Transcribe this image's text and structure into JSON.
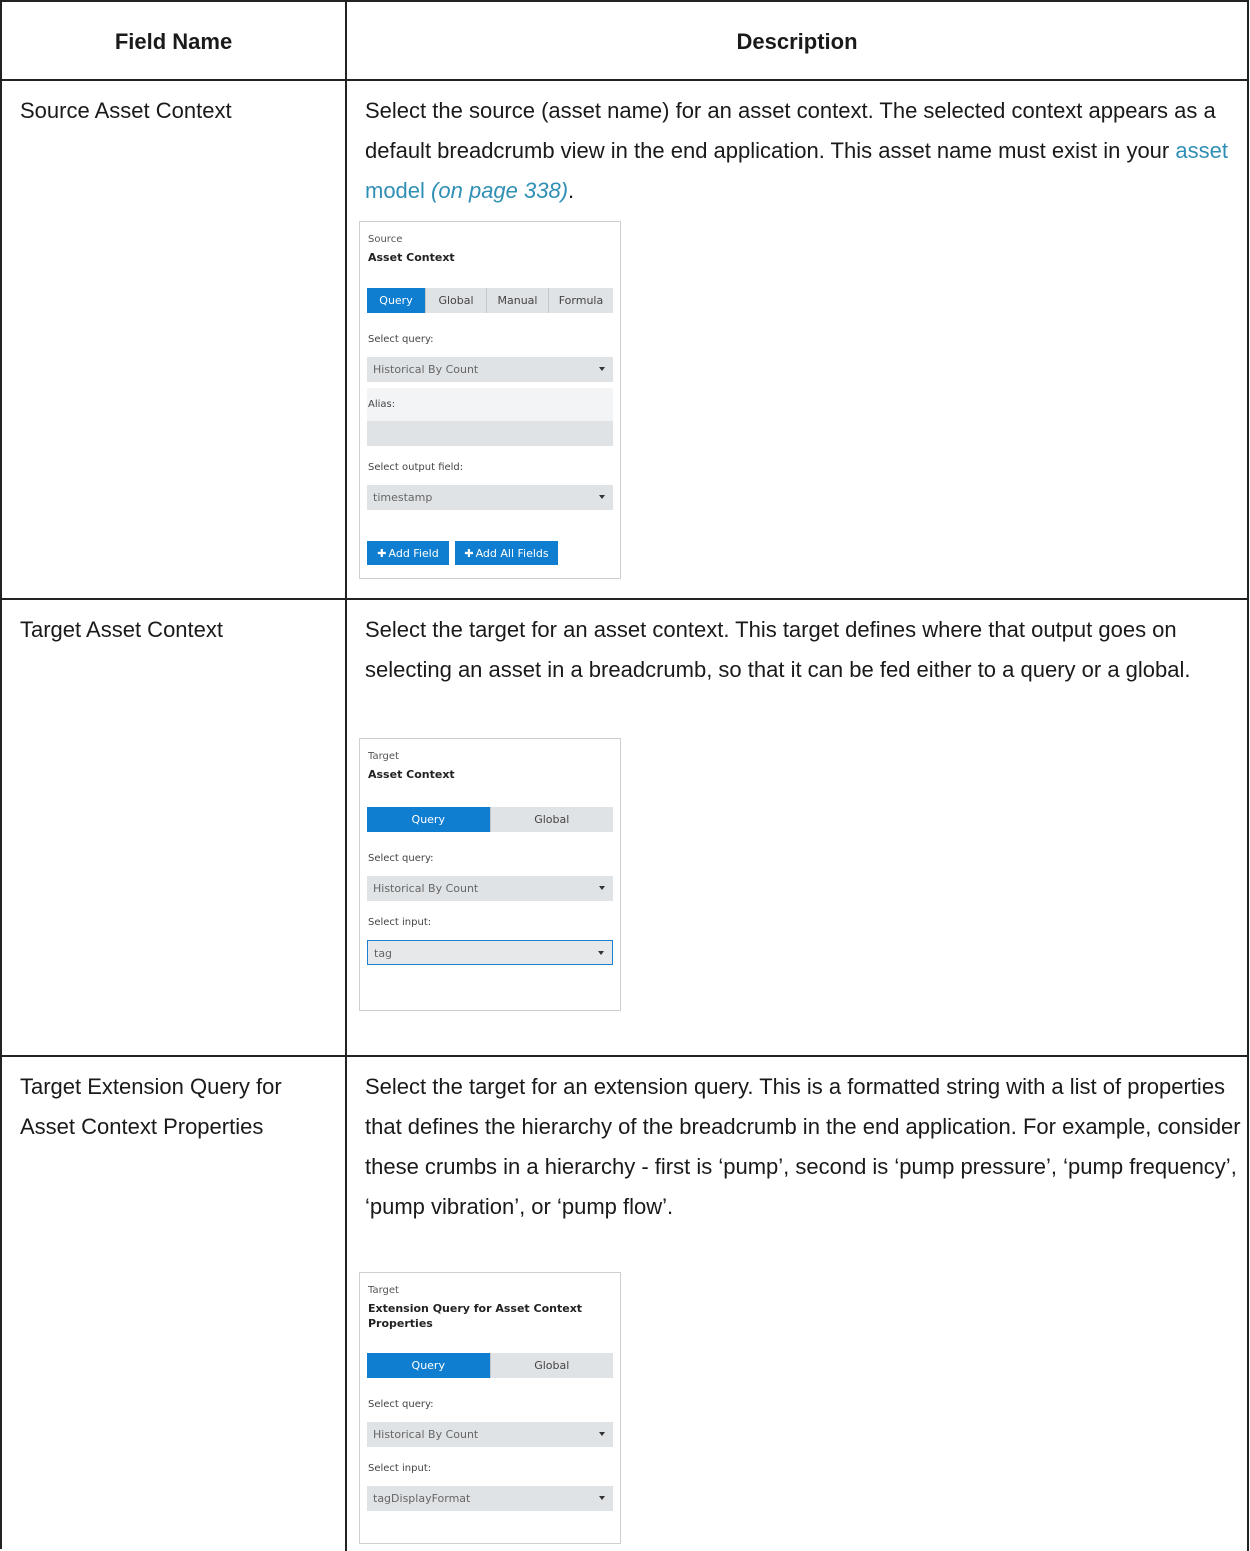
{
  "table": {
    "headers": [
      "Field Name",
      "Description"
    ],
    "rows": [
      {
        "field": "Source Asset Context",
        "desc_text": "Select the source (asset name) for an asset context. The selected context appears as a default breadcrumb view in the end application. This asset name must exist in your ",
        "link_text": "asset model",
        "link_ref": "(on page 338)",
        "desc_end": "."
      },
      {
        "field": "Target Asset Context",
        "desc_text": "Select the target for an asset context. This target defines where that output goes on selecting an asset in a breadcrumb, so that it can be fed either to a query or a global."
      },
      {
        "field": "Target Extension Query for Asset Context Properties",
        "desc_text": "Select the target for an extension query. This is a formatted string with a list of properties that defines the hierarchy of the breadcrumb in the end application. For example, consider these crumbs in a hierarchy - first is ‘pump’, second is ‘pump pressure’, ‘pump frequency’, ‘pump vibration’, or ‘pump flow’."
      }
    ]
  },
  "panel_source": {
    "kicker": "Source",
    "title": "Asset Context",
    "tabs": [
      "Query",
      "Global",
      "Manual",
      "Formula"
    ],
    "active_tab": "Query",
    "select_query_label": "Select query:",
    "select_query_value": "Historical By Count",
    "alias_label": "Alias:",
    "alias_value": "",
    "output_field_label": "Select output field:",
    "output_field_value": "timestamp",
    "add_field_label": "Add Field",
    "add_all_fields_label": "Add All Fields"
  },
  "panel_target": {
    "kicker": "Target",
    "title": "Asset Context",
    "tabs": [
      "Query",
      "Global"
    ],
    "active_tab": "Query",
    "select_query_label": "Select query:",
    "select_query_value": "Historical By Count",
    "select_input_label": "Select input:",
    "select_input_value": "tag"
  },
  "panel_extension": {
    "kicker": "Target",
    "title": "Extension Query for Asset Context Properties",
    "tabs": [
      "Query",
      "Global"
    ],
    "active_tab": "Query",
    "select_query_label": "Select query:",
    "select_query_value": "Historical By Count",
    "select_input_label": "Select input:",
    "select_input_value": "tagDisplayFormat"
  },
  "colors": {
    "accent": "#0f7ed0",
    "link": "#2f8fb5",
    "control_bg": "#dfe3e6"
  },
  "icons": [
    "plus-icon",
    "chevron-down-icon"
  ]
}
